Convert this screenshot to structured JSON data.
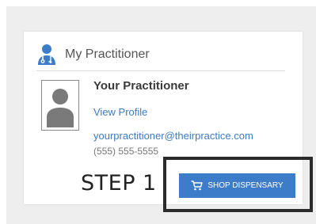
{
  "card": {
    "title": "My Practitioner",
    "icon": "doctor-icon"
  },
  "practitioner": {
    "name": "Your Practitioner",
    "profile_link_label": "View Profile",
    "email": "yourpractitioner@theirpractice.com",
    "phone": "(555) 555-5555",
    "avatar_icon": "person-silhouette-icon"
  },
  "annotation": {
    "step_label": "STEP 1"
  },
  "shop_button": {
    "label": "SHOP DISPENSARY",
    "icon": "cart-icon",
    "color": "#3d7cc9"
  },
  "colors": {
    "link": "#3f7ac0",
    "backdrop": "#eeeeee",
    "highlight_border": "#2b2b2b"
  }
}
